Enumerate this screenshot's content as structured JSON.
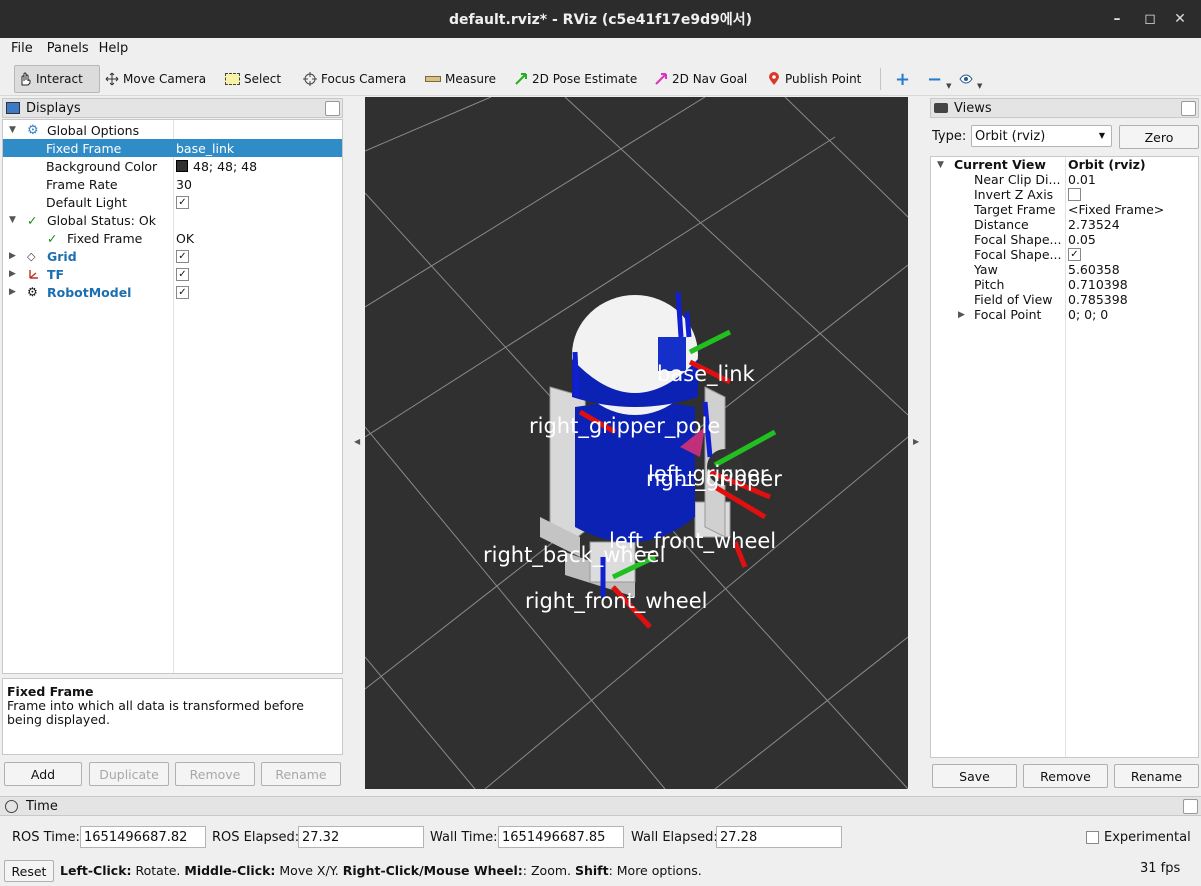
{
  "window": {
    "title": "default.rviz* - RViz (c5e41f17e9d9에서)"
  },
  "menu": {
    "file": "File",
    "panels": "Panels",
    "help": "Help"
  },
  "toolbar": {
    "interact": "Interact",
    "move_camera": "Move Camera",
    "select": "Select",
    "focus_camera": "Focus Camera",
    "measure": "Measure",
    "pose_estimate": "2D Pose Estimate",
    "nav_goal": "2D Nav Goal",
    "publish_point": "Publish Point"
  },
  "displays": {
    "title": "Displays",
    "global_options": "Global Options",
    "fixed_frame_label": "Fixed Frame",
    "fixed_frame_value": "base_link",
    "bg_color_label": "Background Color",
    "bg_color_value": "48; 48; 48",
    "frame_rate_label": "Frame Rate",
    "frame_rate_value": "30",
    "default_light_label": "Default Light",
    "global_status": "Global Status: Ok",
    "status_fixed_frame_label": "Fixed Frame",
    "status_fixed_frame_value": "OK",
    "grid": "Grid",
    "tf": "TF",
    "robot_model": "RobotModel",
    "desc_title": "Fixed Frame",
    "desc_text": "Frame into which all data is transformed before being displayed.",
    "add": "Add",
    "duplicate": "Duplicate",
    "remove": "Remove",
    "rename": "Rename"
  },
  "viewport": {
    "background": "#303030",
    "labels": {
      "base_link": "base_link",
      "right_gripper_pole": "right_gripper_pole",
      "right_gripper": "right_gripper",
      "left_gripper": "left_gripper",
      "right_back_wheel": "right_back_wheel",
      "right_front_wheel": "right_front_wheel",
      "left_front_wheel": "left_front_wheel"
    }
  },
  "views": {
    "title": "Views",
    "type_label": "Type:",
    "type_value": "Orbit (rviz)",
    "zero": "Zero",
    "current_view": "Current View",
    "current_view_value": "Orbit (rviz)",
    "props": [
      {
        "label": "Near Clip Di...",
        "value": "0.01"
      },
      {
        "label": "Invert Z Axis",
        "value": ""
      },
      {
        "label": "Target Frame",
        "value": "<Fixed Frame>"
      },
      {
        "label": "Distance",
        "value": "2.73524"
      },
      {
        "label": "Focal Shape...",
        "value": "0.05"
      },
      {
        "label": "Focal Shape...",
        "value": ""
      },
      {
        "label": "Yaw",
        "value": "5.60358"
      },
      {
        "label": "Pitch",
        "value": "0.710398"
      },
      {
        "label": "Field of View",
        "value": "0.785398"
      },
      {
        "label": "Focal Point",
        "value": "0; 0; 0"
      }
    ],
    "save": "Save",
    "remove": "Remove",
    "rename": "Rename"
  },
  "time": {
    "title": "Time",
    "ros_time_label": "ROS Time:",
    "ros_time": "1651496687.82",
    "ros_elapsed_label": "ROS Elapsed:",
    "ros_elapsed": "27.32",
    "wall_time_label": "Wall Time:",
    "wall_time": "1651496687.85",
    "wall_elapsed_label": "Wall Elapsed:",
    "wall_elapsed": "27.28",
    "experimental": "Experimental"
  },
  "status": {
    "reset": "Reset",
    "left_click": "Left-Click:",
    "left_click_text": " Rotate. ",
    "middle_click": "Middle-Click:",
    "middle_click_text": " Move X/Y. ",
    "right_click": "Right-Click/Mouse Wheel:",
    "right_click_text": ": Zoom. ",
    "shift": "Shift",
    "shift_text": ": More options.",
    "fps": "31 fps"
  }
}
